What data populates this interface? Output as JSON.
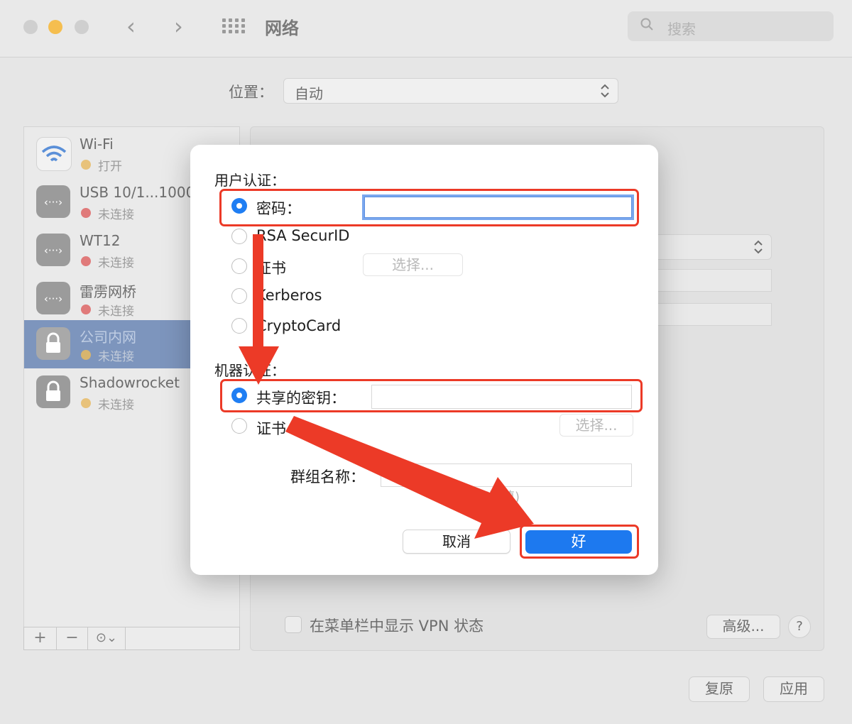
{
  "window": {
    "title": "网络",
    "nav_back": "‹",
    "nav_forward": "›",
    "search_placeholder": "搜索"
  },
  "location": {
    "label": "位置：",
    "value": "自动"
  },
  "services": [
    {
      "name": "Wi-Fi",
      "status": "打开",
      "status_color": "#e8c27a",
      "icon": "wifi-icon"
    },
    {
      "name": "USB 10/1...1000",
      "status": "未连接",
      "status_color": "#e07a7a",
      "icon": "ethernet-icon"
    },
    {
      "name": "WT12",
      "status": "未连接",
      "status_color": "#e07a7a",
      "icon": "ethernet-icon"
    },
    {
      "name": "雷雳网桥",
      "status": "未连接",
      "status_color": "#e07a7a",
      "icon": "ethernet-icon"
    },
    {
      "name": "公司内网",
      "status": "未连接",
      "status_color": "#d8b56e",
      "icon": "lock-icon",
      "selected": true
    },
    {
      "name": "Shadowrocket",
      "status": "未连接",
      "status_color": "#e8c27a",
      "icon": "lock-icon"
    }
  ],
  "sidebar_toolbar": {
    "add": "+",
    "remove": "−",
    "action": "⊙⌄"
  },
  "panel": {
    "show_vpn_status": "在菜单栏中显示 VPN 状态",
    "advanced": "高级...",
    "help": "?",
    "revert": "复原",
    "apply": "应用"
  },
  "dialog": {
    "user_auth_title": "用户认证：",
    "user_auth_options": [
      {
        "label": "密码：",
        "selected": true
      },
      {
        "label": "RSA SecurID",
        "selected": false
      },
      {
        "label": "证书",
        "selected": false
      },
      {
        "label": "Kerberos",
        "selected": false
      },
      {
        "label": "CryptoCard",
        "selected": false
      }
    ],
    "password_value": "",
    "user_choose_button": "选择...",
    "machine_auth_title": "机器认证：",
    "machine_auth_options": [
      {
        "label": "共享的密钥：",
        "selected": true
      },
      {
        "label": "证书",
        "selected": false
      }
    ],
    "shared_secret_value": "",
    "machine_choose_button": "选择...",
    "group_name_label": "群组名称：",
    "group_name_value": "",
    "group_name_hint": "(选填)",
    "cancel": "取消",
    "ok": "好"
  },
  "colors": {
    "accent_blue": "#1d79ef",
    "annotation_red": "#ec3a27"
  }
}
